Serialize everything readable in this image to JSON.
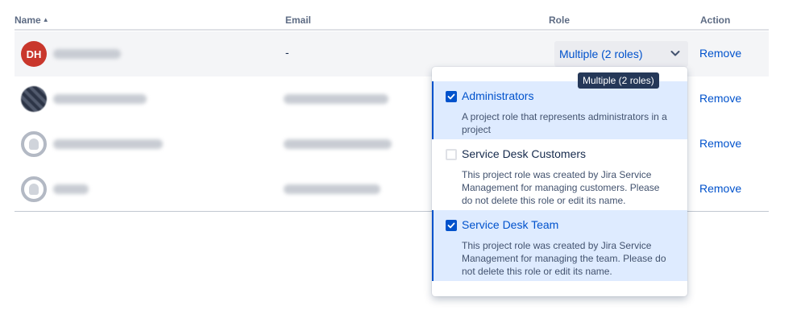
{
  "table": {
    "headers": {
      "name": "Name",
      "email": "Email",
      "role": "Role",
      "action": "Action"
    },
    "rows": [
      {
        "avatar_initials": "DH",
        "email": "-",
        "role": "Multiple (2 roles)",
        "action": "Remove"
      },
      {
        "action": "Remove"
      },
      {
        "action": "Remove"
      },
      {
        "action": "Remove"
      }
    ]
  },
  "tooltip": "Multiple (2 roles)",
  "dropdown": {
    "options": [
      {
        "title": "Administrators",
        "description": "A project role that represents administrators in a project",
        "checked": true
      },
      {
        "title": "Service Desk Customers",
        "description": "This project role was created by Jira Service Management for managing customers. Please do not delete this role or edit its name.",
        "checked": false
      },
      {
        "title": "Service Desk Team",
        "description": "This project role was created by Jira Service Management for managing the team. Please do not delete this role or edit its name.",
        "checked": true
      }
    ]
  },
  "colors": {
    "link": "#0052cc",
    "selected_bg": "#deebff",
    "avatar_red": "#c9372c",
    "tooltip_bg": "#253858"
  },
  "icons": {
    "sort": "sort-ascending-icon",
    "chevron": "chevron-down-icon",
    "checkbox": "checkbox-icon"
  }
}
